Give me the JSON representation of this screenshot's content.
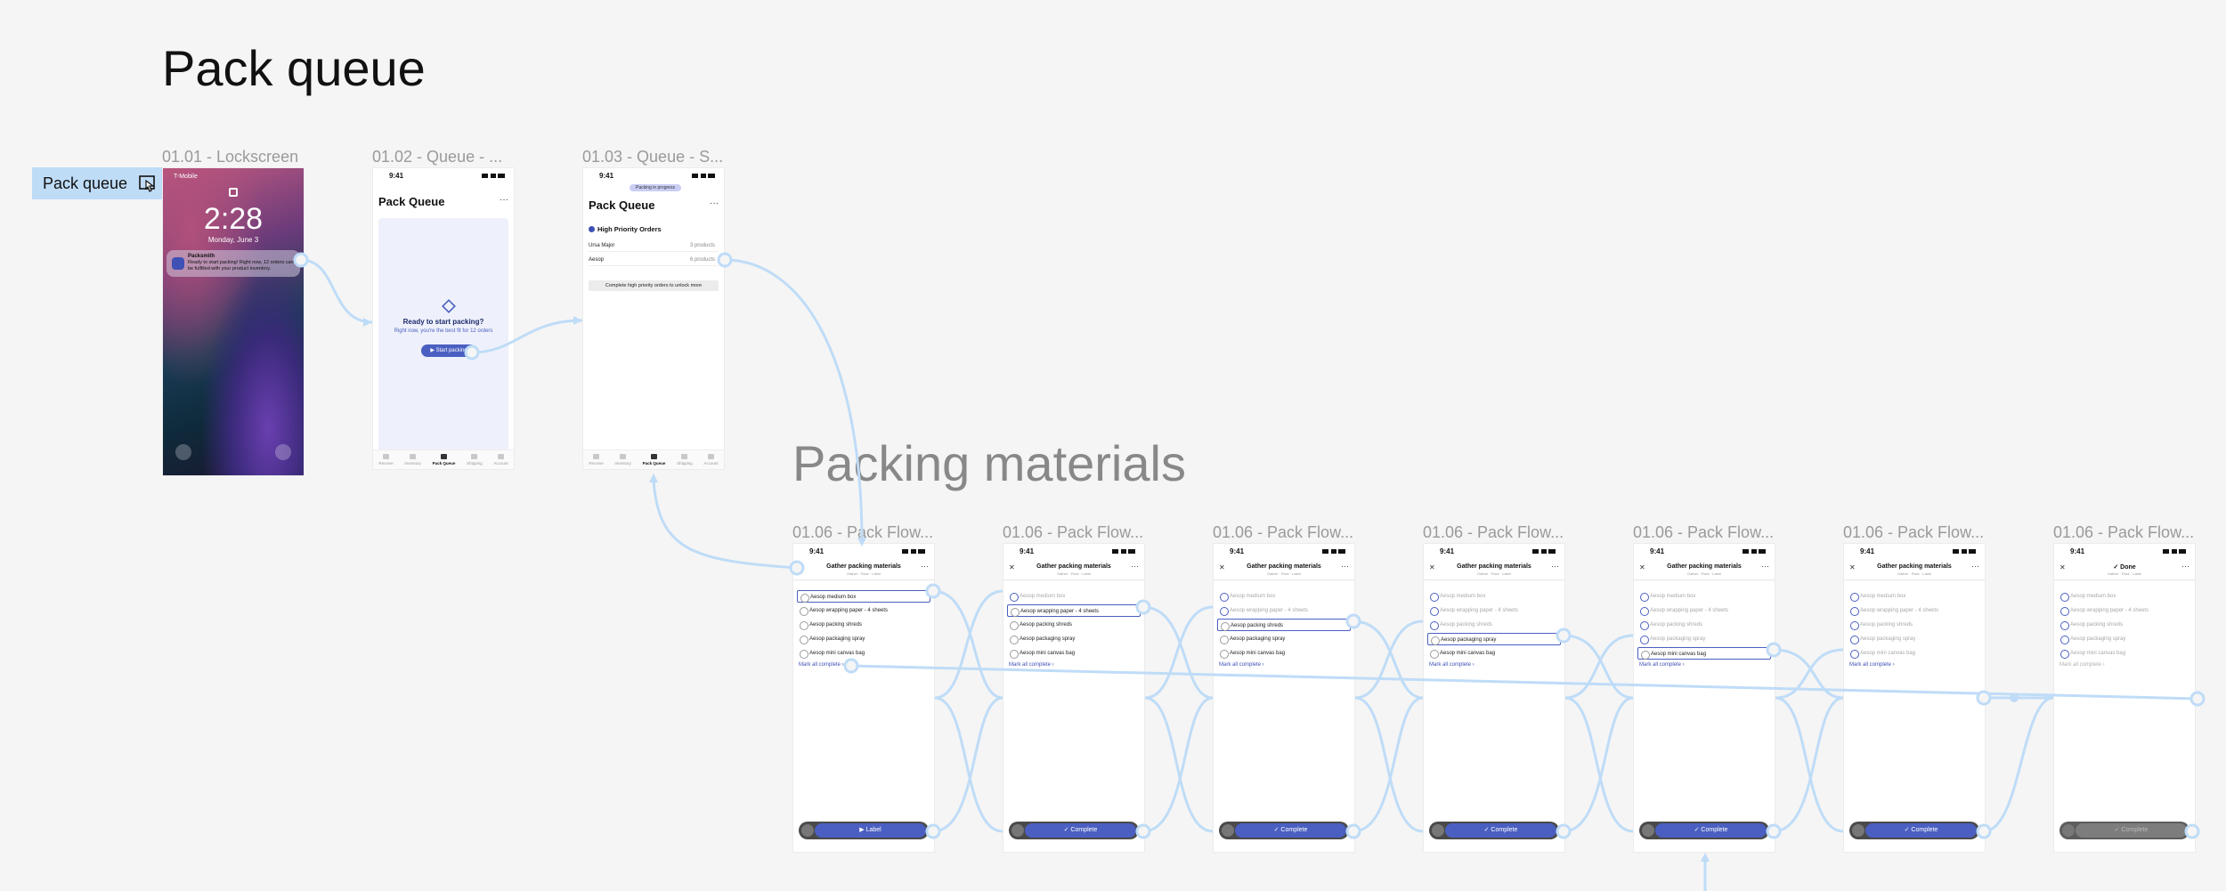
{
  "sections": {
    "pack_queue": "Pack queue",
    "packing_materials": "Packing materials"
  },
  "flow_tag": {
    "label": "Pack queue",
    "icon": "play-cursor-icon"
  },
  "frames": {
    "lockscreen": {
      "label": "01.01 - Lockscreen",
      "carrier": "T-Mobile",
      "time": "2:28",
      "date": "Monday, June 3",
      "notif_title": "Packsmith",
      "notif_time": "now",
      "notif_body": "Ready to start packing! Right now, 12 orders can be fulfilled with your product inventory."
    },
    "queue_empty": {
      "label": "01.02 - Queue - ...",
      "status_time": "9:41",
      "title": "Pack Queue",
      "more": "···",
      "heading": "Ready to start packing?",
      "sub": "Right now, you're the best fit for 12 orders",
      "button": "▶ Start packing"
    },
    "queue_started": {
      "label": "01.03 - Queue - S...",
      "status_time": "9:41",
      "pill": "Packing in progress",
      "title": "Pack Queue",
      "more": "···",
      "priority_heading": "High Priority Orders",
      "rows": [
        {
          "name": "Ursa Major",
          "count": "3 products"
        },
        {
          "name": "Aesop",
          "count": "6 products"
        }
      ],
      "unlock": "Complete high priority orders to unlock more"
    }
  },
  "tabbar": [
    "Receive",
    "Inventory",
    "Pack Queue",
    "Shipping",
    "Account"
  ],
  "pack_flow": {
    "frame_label": "01.06 - Pack Flow...",
    "status_time": "9:41",
    "title": "Gather packing materials",
    "steps": "Gather · Pack · Label",
    "done_title": "✓ Done",
    "items": [
      "Aesop medium box",
      "Aesop wrapping paper - 4 sheets",
      "Aesop packing shreds",
      "Aesop packaging spray",
      "Aesop mini canvas bag"
    ],
    "mark_all": "Mark all complete ›",
    "frames": [
      {
        "label_button": "▶ Label",
        "done": [
          0,
          0,
          0,
          0,
          0
        ],
        "active": 0
      },
      {
        "label_button": "✓ Complete",
        "done": [
          1,
          0,
          0,
          0,
          0
        ],
        "active": 1
      },
      {
        "label_button": "✓ Complete",
        "done": [
          1,
          1,
          0,
          0,
          0
        ],
        "active": 2
      },
      {
        "label_button": "✓ Complete",
        "done": [
          1,
          1,
          1,
          0,
          0
        ],
        "active": 3
      },
      {
        "label_button": "✓ Complete",
        "done": [
          1,
          1,
          1,
          1,
          0
        ],
        "active": 4
      },
      {
        "label_button": "✓ Complete",
        "done": [
          1,
          1,
          1,
          1,
          1
        ],
        "active": -1
      },
      {
        "label_button": "✓ Complete",
        "done": [
          1,
          1,
          1,
          1,
          1
        ],
        "active": -1
      }
    ]
  },
  "colors": {
    "accent": "#4a5fc1",
    "wire": "#bfdcf7",
    "canvas": "#f5f5f5"
  }
}
